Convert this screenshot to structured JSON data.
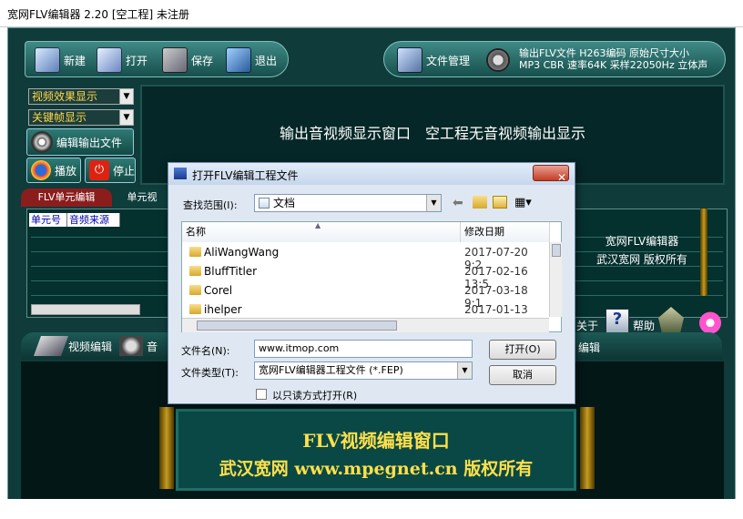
{
  "window": {
    "title": "宽网FLV编辑器 2.20 [空工程] 未注册"
  },
  "toolbar": {
    "new": "新建",
    "open": "打开",
    "save": "保存",
    "exit": "退出",
    "file_manage": "文件管理",
    "output_info_line1": "输出FLV文件 H263编码 原始尺寸大小",
    "output_info_line2": "MP3 CBR 速率64K 采样22050Hz 立体声"
  },
  "controls": {
    "video_effect": "视频效果显示",
    "keyframe": "关键帧显示",
    "edit_output": "编辑输出文件",
    "play": "播放",
    "stop": "停止"
  },
  "display": {
    "message": "输出音视频显示窗口　空工程无音视频输出显示"
  },
  "unit_tabs": {
    "tab1": "FLV单元编辑",
    "tab2": "单元视"
  },
  "grid": {
    "headers": [
      "单元号",
      "音频来源"
    ]
  },
  "about": {
    "line1": "宽网FLV编辑器",
    "line2": "武汉宽网 版权所有",
    "about_btn": "关于",
    "help_btn": "帮助"
  },
  "bottom_tabs": {
    "video_edit": "视频编辑",
    "audio": "音",
    "right_tab": "编辑"
  },
  "editor": {
    "line1": "FLV视频编辑窗口",
    "line2": "武汉宽网 www.mpegnet.cn 版权所有"
  },
  "dialog": {
    "title": "打开FLV编辑工程文件",
    "close": "✕",
    "look_in_label": "查找范围(I):",
    "look_in_value": "文档",
    "columns": {
      "name": "名称",
      "date": "修改日期"
    },
    "files": [
      {
        "name": "AliWangWang",
        "date": "2017-07-20 9:2"
      },
      {
        "name": "BluffTitler",
        "date": "2017-02-16 13:5"
      },
      {
        "name": "Corel",
        "date": "2017-03-18 9:1"
      },
      {
        "name": "ihelper",
        "date": "2017-01-13 10:"
      }
    ],
    "filename_label": "文件名(N):",
    "filename_value": "www.itmop.com",
    "filetype_label": "文件类型(T):",
    "filetype_value": "宽网FLV编辑器工程文件 (*.FEP)",
    "readonly_label": "以只读方式打开(R)",
    "open_btn": "打开(O)",
    "cancel_btn": "取消"
  }
}
